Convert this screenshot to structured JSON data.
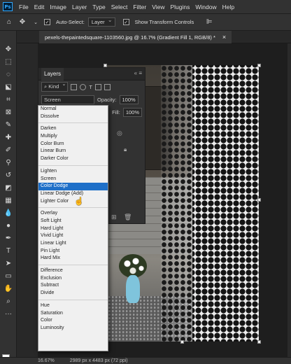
{
  "app": {
    "logo": "Ps"
  },
  "menubar": {
    "items": [
      "File",
      "Edit",
      "Image",
      "Layer",
      "Type",
      "Select",
      "Filter",
      "View",
      "Plugins",
      "Window",
      "Help"
    ]
  },
  "options": {
    "home_icon": "home-icon",
    "auto_select_label": "Auto-Select:",
    "auto_select_checked": "✓",
    "auto_select_value": "Layer",
    "transform_label": "Show Transform Controls",
    "transform_checked": "✓"
  },
  "document": {
    "tab_title": "pexels-thepaintedsquare-1103560.jpg @ 16.7% (Gradient Fill 1, RGB/8) *",
    "close": "×"
  },
  "layers_panel": {
    "title": "Layers",
    "controls": "«  ≡",
    "filter_label": "Kind",
    "blend_mode": "Screen",
    "opacity_label": "Opacity:",
    "opacity_value": "100%",
    "fill_label": "Fill:",
    "fill_value": "100%"
  },
  "blend_menu": {
    "groups": [
      [
        "Normal",
        "Dissolve"
      ],
      [
        "Darken",
        "Multiply",
        "Color Burn",
        "Linear Burn",
        "Darker Color"
      ],
      [
        "Lighten",
        "Screen",
        "Color Dodge",
        "Linear Dodge (Add)",
        "Lighter Color"
      ],
      [
        "Overlay",
        "Soft Light",
        "Hard Light",
        "Vivid Light",
        "Linear Light",
        "Pin Light",
        "Hard Mix"
      ],
      [
        "Difference",
        "Exclusion",
        "Subtract",
        "Divide"
      ],
      [
        "Hue",
        "Saturation",
        "Color",
        "Luminosity"
      ]
    ],
    "highlighted": "Color Dodge"
  },
  "status": {
    "zoom": "16.67%",
    "doc_size": "2989 px x 4483 px (72 ppi)"
  },
  "colors": {
    "accent": "#1e6fc8",
    "panel": "#323232",
    "menu_bg": "#f0f0f0"
  }
}
